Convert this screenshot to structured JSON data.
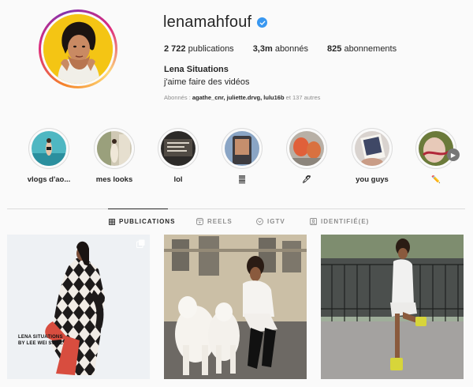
{
  "profile": {
    "username": "lenamahfouf",
    "verified_icon": "verified-badge-icon",
    "stats": {
      "posts_count": "2 722",
      "posts_label": " publications",
      "followers_count": "3,3m",
      "followers_label": " abonnés",
      "following_count": "825",
      "following_label": " abonnements"
    },
    "full_name": "Lena Situations",
    "bio": "j'aime faire des vidéos",
    "followed_by_prefix": "Abonnés : ",
    "followed_by_users": "agathe_cnr, juliette.drvg, lulu16b",
    "followed_by_suffix": " et 137 autres"
  },
  "highlights": [
    {
      "label": "vlogs d'ao..."
    },
    {
      "label": "mes looks"
    },
    {
      "label": "lol"
    },
    {
      "label": "𝄛"
    },
    {
      "label": "🖊"
    },
    {
      "label": "you guys"
    },
    {
      "label": "✏️"
    }
  ],
  "tabs": [
    {
      "label": "PUBLICATIONS",
      "icon": "grid-icon",
      "active": true
    },
    {
      "label": "REELS",
      "icon": "reels-icon",
      "active": false
    },
    {
      "label": "IGTV",
      "icon": "igtv-icon",
      "active": false
    },
    {
      "label": "IDENTIFIÉ(E)",
      "icon": "tagged-icon",
      "active": false
    }
  ],
  "posts": [
    {
      "caption_line1": "LENA SITUATIONS",
      "caption_line2": "BY LEE WEI SWEE",
      "multi": true
    },
    {
      "caption_line1": "",
      "caption_line2": "",
      "multi": false
    },
    {
      "caption_line1": "",
      "caption_line2": "",
      "multi": false
    }
  ],
  "colors": {
    "accent": "#3897f0",
    "text": "#262626",
    "muted": "#8e8e8e",
    "border": "#dbdbdb",
    "background": "#fafafa"
  }
}
